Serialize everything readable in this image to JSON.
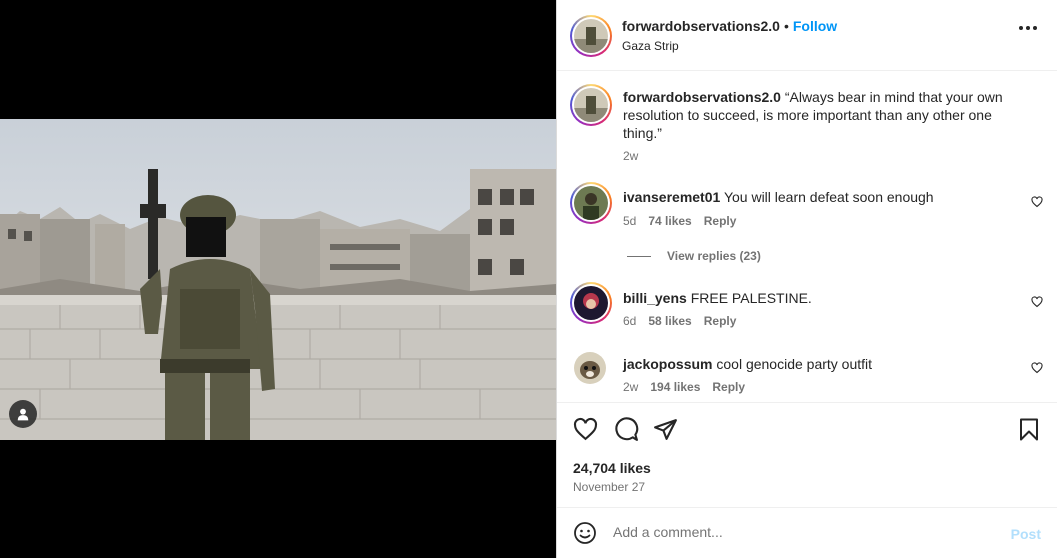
{
  "post": {
    "username": "forwardobservations2.0",
    "follow_label": "Follow",
    "location": "Gaza Strip",
    "more_icon": "more-horizontal-icon"
  },
  "caption": {
    "username": "forwardobservations2.0",
    "text": "“Always bear in mind that your own resolution to succeed, is more important than any other one thing.”",
    "time": "2w"
  },
  "comments": [
    {
      "username": "ivanseremet01",
      "text": "You will learn defeat soon enough",
      "time": "5d",
      "likes": "74 likes",
      "reply": "Reply"
    },
    {
      "username": "billi_yens",
      "text": "FREE PALESTINE.",
      "time": "6d",
      "likes": "58 likes",
      "reply": "Reply"
    },
    {
      "username": "jackopossum",
      "text": "cool genocide party outfit",
      "time": "2w",
      "likes": "194 likes",
      "reply": "Reply"
    }
  ],
  "view_replies": "View replies (23)",
  "actions": {
    "like_icon": "heart-icon",
    "comment_icon": "comment-icon",
    "share_icon": "share-icon",
    "save_icon": "bookmark-icon",
    "likes_count": "24,704 likes",
    "date": "November 27"
  },
  "add_comment": {
    "placeholder": "Add a comment...",
    "post_label": "Post"
  },
  "colors": {
    "accent": "#0095f6",
    "post_disabled": "#b2dffc",
    "muted": "#737373"
  }
}
